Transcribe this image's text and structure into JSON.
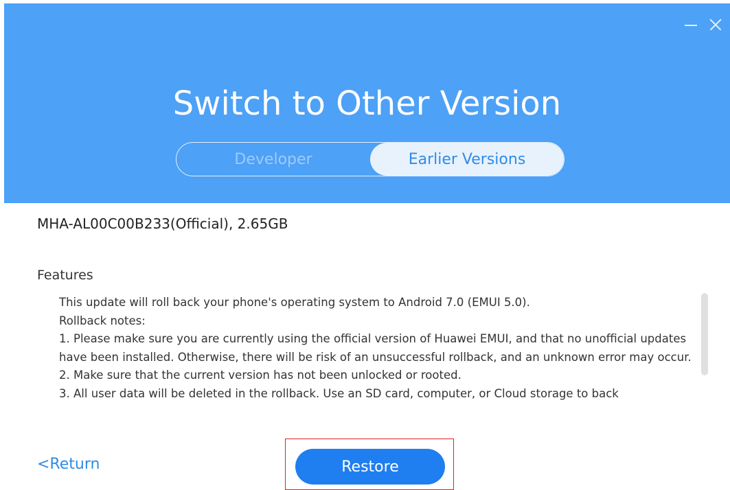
{
  "header": {
    "title": "Switch to Other Version",
    "tabs": [
      {
        "label": "Developer",
        "active": false
      },
      {
        "label": "Earlier Versions",
        "active": true
      }
    ],
    "window_controls": {
      "minimize_icon": "minimize-icon",
      "close_icon": "close-icon"
    },
    "background_color": "#4da1f6"
  },
  "main": {
    "version_info": "MHA-AL00C00B233(Official), 2.65GB",
    "features_label": "Features",
    "notes": [
      "This update will roll back your phone's operating system to Android 7.0 (EMUI 5.0).",
      "Rollback notes:",
      "1. Please make sure you are currently using the official version of Huawei EMUI, and that no unofficial updates have been installed. Otherwise, there will be risk of an unsuccessful rollback, and an unknown error may occur.",
      "2. Make sure that the current version has not been unlocked or rooted.",
      "3. All user data will be deleted in the rollback. Use an SD card, computer, or Cloud storage to back"
    ]
  },
  "footer": {
    "return_label": "<Return",
    "restore_label": "Restore",
    "accent_color": "#1f7ef0",
    "highlight_color": "#e02020"
  }
}
